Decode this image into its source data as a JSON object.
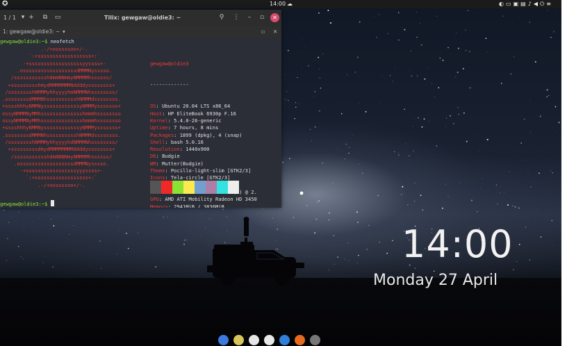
{
  "top_panel": {
    "clock": "14:00",
    "weather_icon": "cloud-icon",
    "tray_icons": [
      "network-icon",
      "folder-icon",
      "display-icon",
      "lock-icon",
      "notification-icon",
      "volume-icon",
      "power-icon",
      "menu-icon"
    ]
  },
  "terminal": {
    "tab_count": "1 / 1",
    "title": "Tilix: gewgaw@oldie3: ~",
    "session": "1: gewgaw@oldie3: ~",
    "prompt": "gewgaw@oldie3:~$",
    "command": "neofetch",
    "user_host": "gewgaw@oldie3",
    "separator": "-------------",
    "info": [
      {
        "key": "OS",
        "value": "Ubuntu 20.04 LTS x86_64"
      },
      {
        "key": "Host",
        "value": "HP EliteBook 6930p F.16"
      },
      {
        "key": "Kernel",
        "value": "5.4.0-26-generic"
      },
      {
        "key": "Uptime",
        "value": "7 hours, 8 mins"
      },
      {
        "key": "Packages",
        "value": "1899 (dpkg), 4 (snap)"
      },
      {
        "key": "Shell",
        "value": "bash 5.0.16"
      },
      {
        "key": "Resolution",
        "value": "1440x900"
      },
      {
        "key": "DE",
        "value": "Budgie"
      },
      {
        "key": "WM",
        "value": "Mutter(Budgie)"
      },
      {
        "key": "Theme",
        "value": "Pocillo-light-slim [GTK2/3]"
      },
      {
        "key": "Icons",
        "value": "Tela-circle [GTK2/3]"
      },
      {
        "key": "Terminal",
        "value": "tilix"
      },
      {
        "key": "CPU",
        "value": "Intel Core 2 Duo P8700 (2) @ 2."
      },
      {
        "key": "GPU",
        "value": "AMD ATI Mobility Radeon HD 3450"
      },
      {
        "key": "Memory",
        "value": "2941MiB / 3836MiB"
      }
    ],
    "palette": [
      "#555555",
      "#ef2929",
      "#8ae234",
      "#fce94f",
      "#729fcf",
      "#ad7fa8",
      "#34e2e2",
      "#eeeeec"
    ],
    "ascii_logo": [
      "                 .-/+oossssoo+/-.",
      "             `:+ssssssssssssssssss+:`",
      "           -+ssssssssssssssssssyyssss+-",
      "         .ossssssssssssssssssdMMMNysssso.",
      "       /ssssssssssshdmmNNmmyNMMMMhssssss/",
      "      +ssssssssshmydMMMMMMMNddddyssssssss+",
      "     /sssssssshNMMMyhhyyyyhmNMMMNhssssssss/",
      "    .ssssssssdMMMNhsssssssssshNMMMdssssssss.",
      "    +sssshhhyNMMNyssssssssssssyNMMMysssssss+",
      "    ossyNMMMNyMMhsssssssssssssshmmmhssssssso",
      "    ossyNMMMNyMMhsssssssssssssshmmmhssssssso",
      "    +sssshhhyNMMNyssssssssssssyNMMMysssssss+",
      "    .ssssssssdMMMNhsssssssssshNMMMdssssssss.",
      "     /sssssssshNMMMyhhyyyyhdNMMMNhssssssss/",
      "      +sssssssssdmydMMMMMMMMddddyssssssss+",
      "       /ssssssssssshdmNNNNmyNMMMMhssssss/",
      "        .ossssssssssssssssssdMMMNysssso.",
      "          -+sssssssssssssssssyyyssss+-",
      "            `:+ssssssssssssssssss+:`",
      "                .-/+oossssoo+/-."
    ],
    "bottom_prompt": "gewgaw@oldie3:~$"
  },
  "lock_screen": {
    "time": "14:00",
    "date": "Monday 27 April"
  },
  "dock": {
    "items": [
      {
        "name": "budgie-menu-icon",
        "color": "#3d7ae0"
      },
      {
        "name": "rhythmbox-icon",
        "color": "#d6c65a"
      },
      {
        "name": "files-icon",
        "color": "#e6e6e6"
      },
      {
        "name": "chrome-icon",
        "color": "#e8e8e8"
      },
      {
        "name": "software-icon",
        "color": "#2f7fd8"
      },
      {
        "name": "firefox-icon",
        "color": "#e66a1f"
      },
      {
        "name": "settings-icon",
        "color": "#777777"
      }
    ]
  }
}
